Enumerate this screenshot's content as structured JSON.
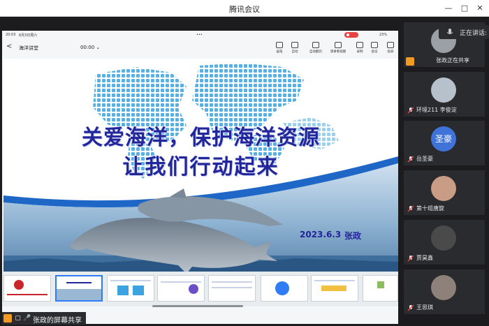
{
  "window": {
    "title": "腾讯会议"
  },
  "phone_status": {
    "time": "20:03",
    "date": "6月3日周六",
    "dots": "•••",
    "battery": "23%"
  },
  "ppt_toolbar": {
    "back": "<",
    "app_title": "海洋讲堂",
    "timer": "00:00 ⌄",
    "tools": [
      "画笔",
      "自动",
      "自动翻页",
      "演讲者视图",
      "录制",
      "会议",
      "投屏"
    ]
  },
  "slide": {
    "title_line1": "关爱海洋，保护海洋资源",
    "title_line2": "让我们行动起来",
    "date": "2023.6.3",
    "author": "张政"
  },
  "thumbnails": {
    "count": 8,
    "active_index": 1
  },
  "share_label": "张政的屏幕共享",
  "speaking": {
    "label": "正在讲话:"
  },
  "participants": [
    {
      "name": "张政正在共享",
      "avatar": "photo-gray",
      "status": "sharing"
    },
    {
      "name": "环境211 李俊淀",
      "avatar": "cartoon-dog",
      "status": "muted"
    },
    {
      "name": "岳圣豪",
      "avatar_text": "圣豪",
      "avatar": "text",
      "status": "muted"
    },
    {
      "name": "第十组唐旋",
      "avatar": "photo-girl",
      "status": "muted"
    },
    {
      "name": "贾昊鑫",
      "avatar": "photo-dark",
      "status": "muted"
    },
    {
      "name": "王思琪",
      "avatar": "photo-girl2",
      "status": "muted"
    }
  ],
  "colors": {
    "accent": "#2f7cf6",
    "slide_title": "#23259a",
    "share_orange": "#f29b22",
    "mic_muted": "#e84343",
    "text_avatar": "#3f73d8"
  }
}
